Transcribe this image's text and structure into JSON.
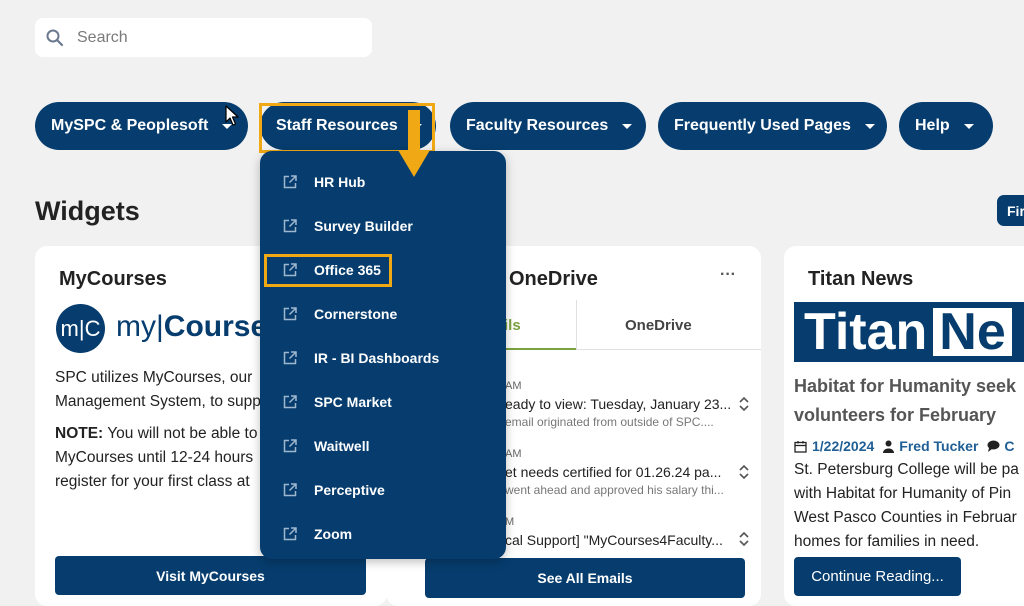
{
  "search": {
    "placeholder": "Search"
  },
  "nav": {
    "items": [
      {
        "label": "MySPC & Peoplesoft"
      },
      {
        "label": "Staff Resources"
      },
      {
        "label": "Faculty Resources"
      },
      {
        "label": "Frequently Used Pages"
      },
      {
        "label": "Help"
      }
    ]
  },
  "dropdown": {
    "items": [
      {
        "label": "HR Hub"
      },
      {
        "label": "Survey Builder"
      },
      {
        "label": "Office 365"
      },
      {
        "label": "Cornerstone"
      },
      {
        "label": "IR - BI Dashboards"
      },
      {
        "label": "SPC Market"
      },
      {
        "label": "Waitwell"
      },
      {
        "label": "Perceptive"
      },
      {
        "label": "Zoom"
      }
    ]
  },
  "widgets": {
    "title": "Widgets",
    "find_button": "Fir"
  },
  "mycourses": {
    "title": "MyCourses",
    "logo_mark": "m|C",
    "logo_word_light": "my|",
    "logo_word_bold": "Courses",
    "para1_line1": "SPC utilizes MyCourses, our",
    "para1_line2": "Management System, to supp",
    "note_label": "NOTE:",
    "note_line1_rest": " You will not be able to",
    "note_line2": "MyCourses until 12-24 hours",
    "note_line3": "register for your first class at",
    "button": "Visit MyCourses"
  },
  "onedrive": {
    "title": "OneDrive",
    "menu": "···",
    "tab_emails": "ils",
    "tab_onedrive": "OneDrive",
    "emails": [
      {
        "time": "AM",
        "subject": "eady to view: Tuesday, January 23...",
        "preview": "email originated from outside of SPC...."
      },
      {
        "time": "AM",
        "subject": "et needs certified for 01.26.24 pa...",
        "preview": "went ahead and approved his salary thi..."
      },
      {
        "time": "M",
        "subject": "cal Support] \"MyCourses4Faculty...",
        "preview": ""
      }
    ],
    "button": "See All Emails"
  },
  "titan": {
    "title": "Titan News",
    "banner_word1": "Titan",
    "banner_word2": "Ne",
    "headline_line1": "Habitat for Humanity seek",
    "headline_line2": "volunteers for February",
    "date": "1/22/2024",
    "author": "Fred Tucker",
    "comments": "C",
    "body_line1": "St. Petersburg College will be pa",
    "body_line2": "with Habitat for Humanity of Pin",
    "body_line3": "West Pasco Counties in Februar",
    "body_line4": "homes for families in need.",
    "button": "Continue Reading..."
  },
  "colors": {
    "brand": "#063d6e",
    "highlight": "#f0a914",
    "tab_accent": "#7ba23f"
  }
}
